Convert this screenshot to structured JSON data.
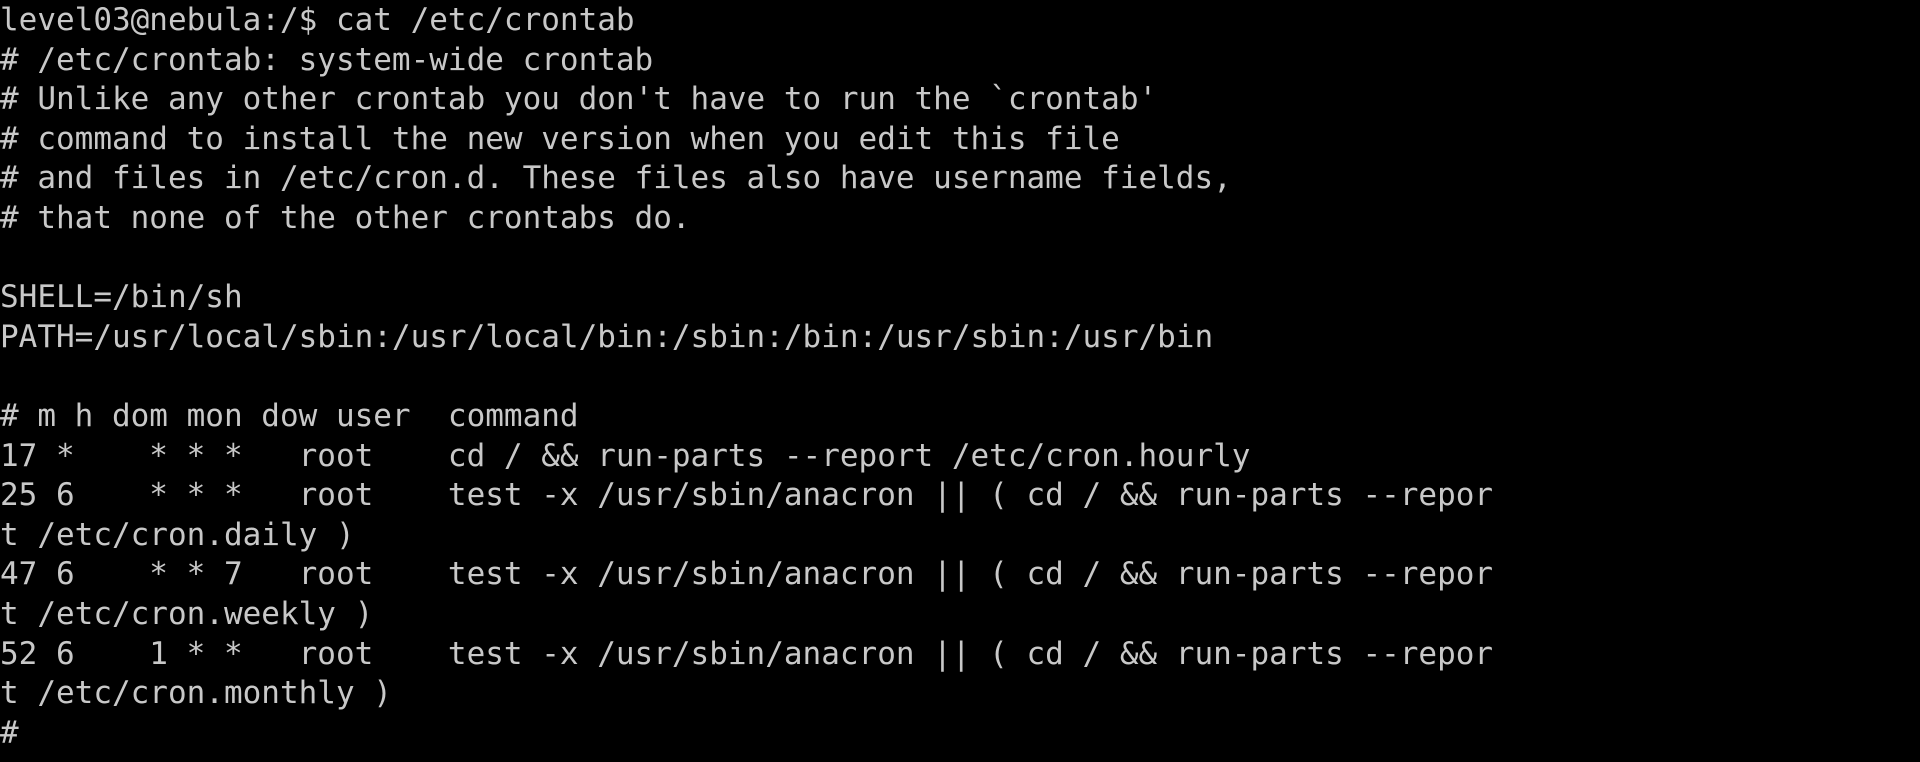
{
  "terminal": {
    "colors": {
      "background": "#000000",
      "foreground": "#c8c8c8"
    },
    "lines": [
      "level03@nebula:/$ cat /etc/crontab",
      "# /etc/crontab: system-wide crontab",
      "# Unlike any other crontab you don't have to run the `crontab'",
      "# command to install the new version when you edit this file",
      "# and files in /etc/cron.d. These files also have username fields,",
      "# that none of the other crontabs do.",
      "",
      "SHELL=/bin/sh",
      "PATH=/usr/local/sbin:/usr/local/bin:/sbin:/bin:/usr/sbin:/usr/bin",
      "",
      "# m h dom mon dow user  command",
      "17 *    * * *   root    cd / && run-parts --report /etc/cron.hourly",
      "25 6    * * *   root    test -x /usr/sbin/anacron || ( cd / && run-parts --repor",
      "t /etc/cron.daily )",
      "47 6    * * 7   root    test -x /usr/sbin/anacron || ( cd / && run-parts --repor",
      "t /etc/cron.weekly )",
      "52 6    1 * *   root    test -x /usr/sbin/anacron || ( cd / && run-parts --repor",
      "t /etc/cron.monthly )",
      "#"
    ]
  }
}
